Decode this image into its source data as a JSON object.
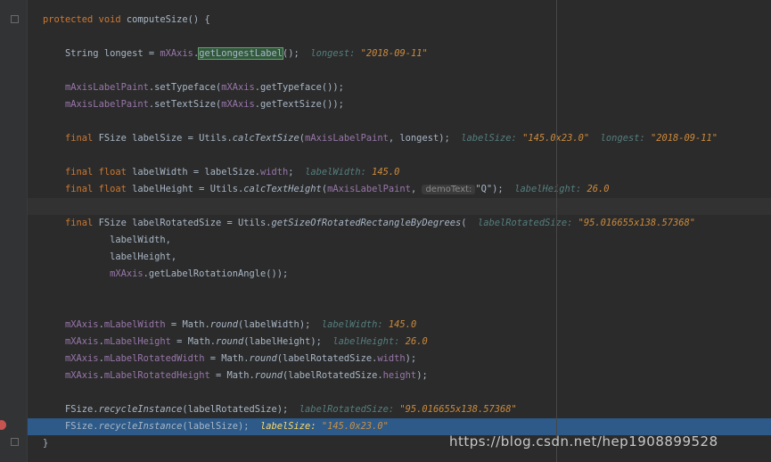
{
  "code": {
    "l1_kw": "protected void ",
    "l1_method": "computeSize",
    "l1_rest": "() {",
    "l3_type": "String longest = ",
    "l3_fld": "mXAxis",
    "l3_dot": ".",
    "l3_call": "getLongestLabel",
    "l3_end": "();",
    "l3_h_label": "longest: ",
    "l3_h_value": "\"2018-09-11\"",
    "l5_fld": "mAxisLabelPaint",
    "l5_mid": ".setTypeface(",
    "l5_fld2": "mXAxis",
    "l5_end": ".getTypeface());",
    "l6_fld": "mAxisLabelPaint",
    "l6_mid": ".setTextSize(",
    "l6_fld2": "mXAxis",
    "l6_end": ".getTextSize());",
    "l8_kw": "final ",
    "l8_mid": "FSize labelSize = Utils.",
    "l8_call": "calcTextSize",
    "l8_open": "(",
    "l8_fld": "mAxisLabelPaint",
    "l8_end": ", longest);",
    "l8_h1_label": "labelSize: ",
    "l8_h1_value": "\"145.0x23.0\"",
    "l8_h2_label": "longest: ",
    "l8_h2_value": "\"2018-09-11\"",
    "l9_kw": "final float ",
    "l9_mid": "labelWidth = labelSize.",
    "l9_fld": "width",
    "l9_end": ";",
    "l9_h_label": "labelWidth: ",
    "l9_h_value": "145.0",
    "l10_kw": "final float ",
    "l10_mid": "labelHeight = Utils.",
    "l10_call": "calcTextHeight",
    "l10_open": "(",
    "l10_fld": "mAxisLabelPaint",
    "l10_comma": ", ",
    "l10_hint": "demoText:",
    "l10_end": "\"Q\");",
    "l10_h_label": "labelHeight: ",
    "l10_h_value": "26.0",
    "l12_kw": "final ",
    "l12_mid": "FSize labelRotatedSize = Utils.",
    "l12_call": "getSizeOfRotatedRectangleByDegrees",
    "l12_open": "(",
    "l12_h_label": "labelRotatedSize: ",
    "l12_h_value": "\"95.016655x138.57368\"",
    "l13": "labelWidth,",
    "l14": "labelHeight,",
    "l15_fld": "mXAxis",
    "l15_end": ".getLabelRotationAngle());",
    "l18_fld": "mXAxis",
    "l18_dot": ".",
    "l18_fld2": "mLabelWidth",
    "l18_mid": " = Math.",
    "l18_call": "round",
    "l18_end": "(labelWidth);",
    "l18_h_label": "labelWidth: ",
    "l18_h_value": "145.0",
    "l19_fld": "mXAxis",
    "l19_dot": ".",
    "l19_fld2": "mLabelHeight",
    "l19_mid": " = Math.",
    "l19_call": "round",
    "l19_end": "(labelHeight);",
    "l19_h_label": "labelHeight: ",
    "l19_h_value": "26.0",
    "l20_fld": "mXAxis",
    "l20_dot": ".",
    "l20_fld2": "mLabelRotatedWidth",
    "l20_mid": " = Math.",
    "l20_call": "round",
    "l20_open": "(labelRotatedSize.",
    "l20_fld3": "width",
    "l20_end": ");",
    "l21_fld": "mXAxis",
    "l21_dot": ".",
    "l21_fld2": "mLabelRotatedHeight",
    "l21_mid": " = Math.",
    "l21_call": "round",
    "l21_open": "(labelRotatedSize.",
    "l21_fld3": "height",
    "l21_end": ");",
    "l23_pre": "FSize.",
    "l23_call": "recycleInstance",
    "l23_end": "(labelRotatedSize);",
    "l23_h_label": "labelRotatedSize: ",
    "l23_h_value": "\"95.016655x138.57368\"",
    "l24_pre": "FSize.",
    "l24_call": "recycleInstance",
    "l24_end": "(labelSize);",
    "l24_h_label": "labelSize: ",
    "l24_h_value": "\"145.0x23.0\"",
    "l25": "}"
  },
  "watermark": "https://blog.csdn.net/hep1908899528",
  "colors": {
    "background": "#2b2b2b",
    "keyword": "#cc7832",
    "field": "#9876aa",
    "inline_value_label": "#557e7e",
    "execution_line": "#2d5a88",
    "breakpoint": "#c75450"
  }
}
